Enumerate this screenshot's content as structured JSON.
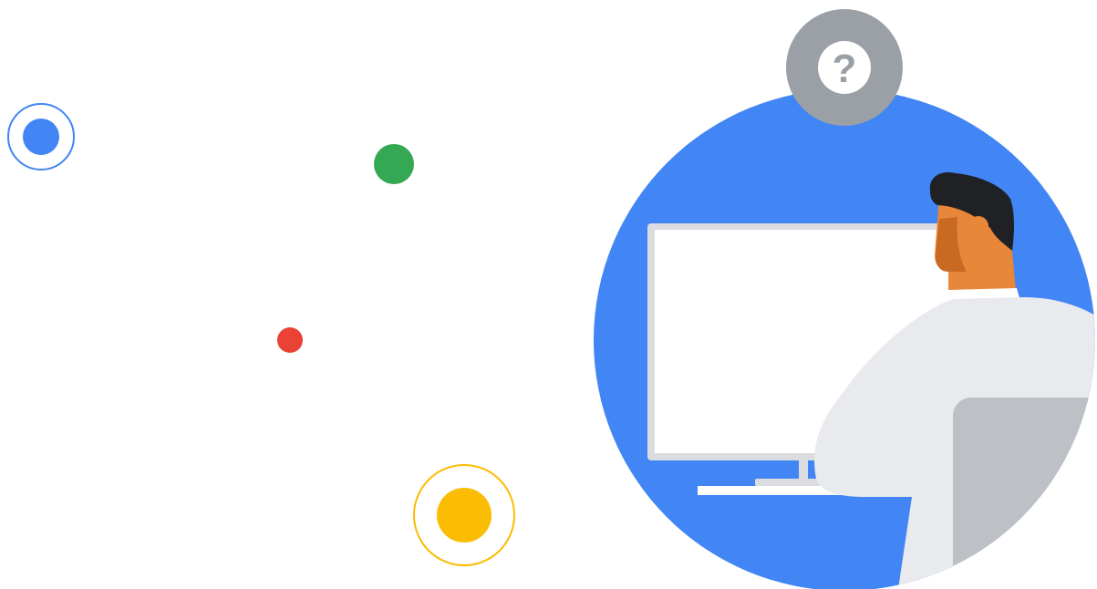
{
  "illustration": {
    "help_glyph": "?",
    "icons": {
      "help": "question-mark-icon",
      "person": "person-at-computer-illustration",
      "monitor": "monitor-icon"
    },
    "colors": {
      "blue": "#4285f4",
      "green": "#34a853",
      "red": "#ea4335",
      "yellow": "#fbbc04",
      "help_badge": "#9aa0a6",
      "screen": "#ffffff",
      "monitor_frame": "#dadce0",
      "shirt": "#e8eaed",
      "chair": "#bdc1c6",
      "skin": "#e8873a",
      "skin_shadow": "#c96a22",
      "hair": "#202124"
    }
  }
}
